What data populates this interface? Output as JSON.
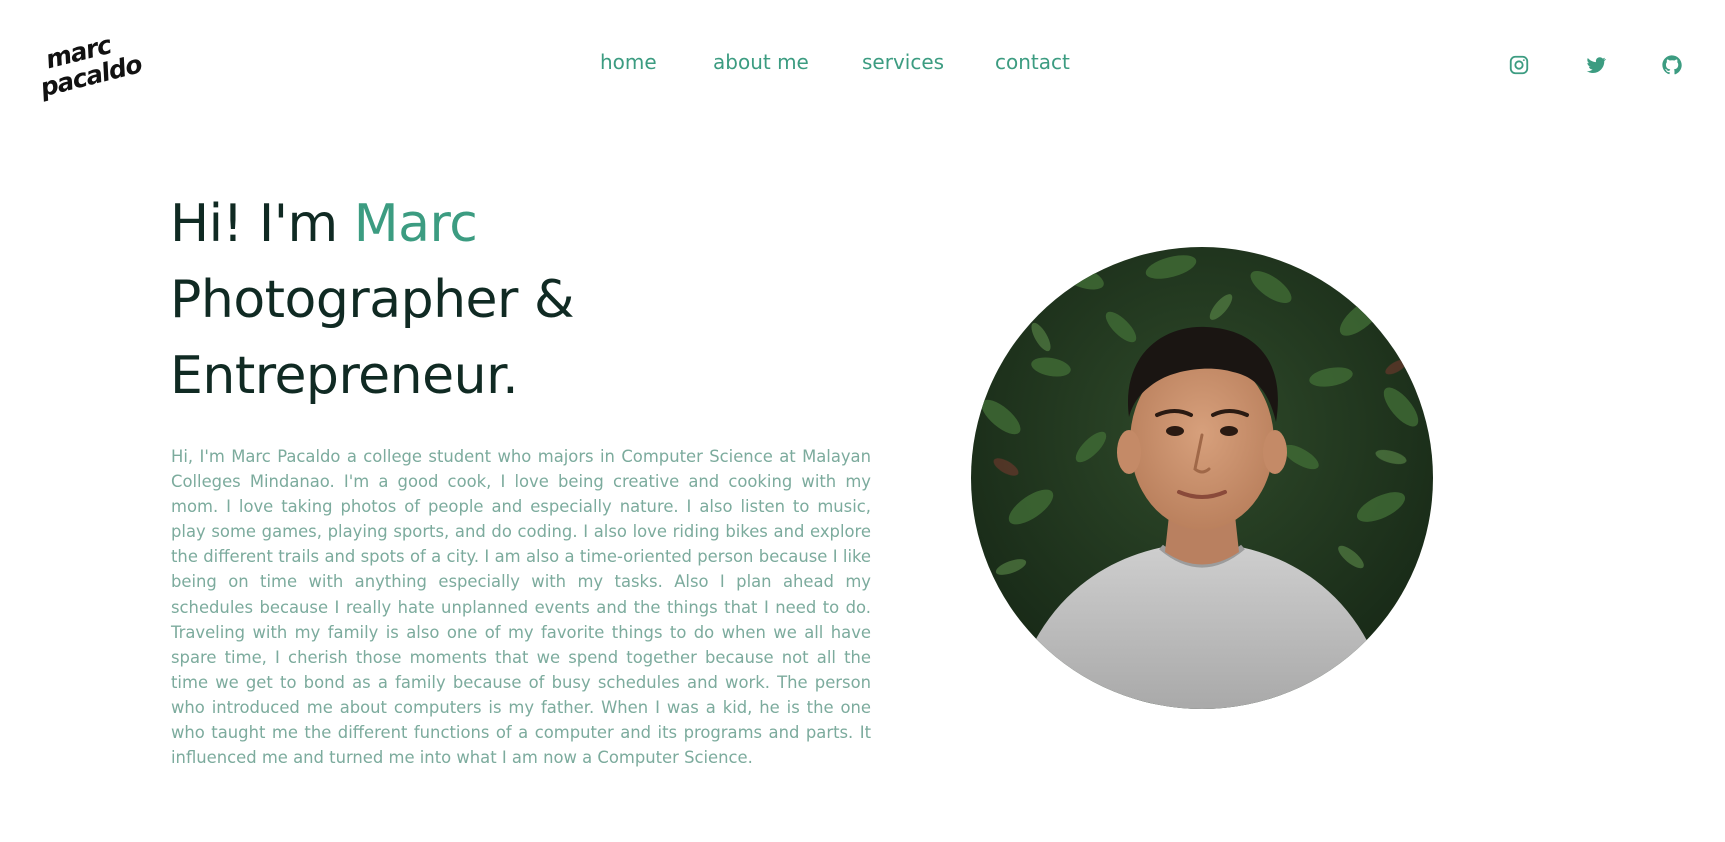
{
  "header": {
    "logo": {
      "line1": "marc",
      "line2": "pacaldo"
    },
    "nav": [
      {
        "label": "home"
      },
      {
        "label": "about me"
      },
      {
        "label": "services"
      },
      {
        "label": "contact"
      }
    ],
    "social": [
      {
        "icon": "instagram-icon"
      },
      {
        "icon": "twitter-icon"
      },
      {
        "icon": "github-icon"
      }
    ]
  },
  "hero": {
    "greeting": "Hi! I'm ",
    "name": "Marc",
    "line2": "Photographer &",
    "line3": "Entrepreneur.",
    "bio": "Hi, I'm Marc Pacaldo a college student who majors in Computer Science at Malayan Colleges Mindanao. I'm a good cook, I love being creative and cooking with my mom. I love taking photos of people and especially nature. I also listen to music, play some games, playing sports, and do coding. I also love riding bikes and explore the different trails and spots of a city. I am also a time-oriented person because I like being on time with anything especially with my tasks. Also I plan ahead my schedules because I really hate unplanned events and the things that I need to do. Traveling with my family is also one of my favorite things to do when we all have spare time, I cherish those moments that we spend together because not all the time we get to bond as a family because of busy schedules and work. The person who introduced me about computers is my father. When I was a kid, he is the one who taught me the different functions of a computer and its programs and parts. It influenced me and turned me into what I am now a Computer Science."
  },
  "colors": {
    "accent": "#3c9c81",
    "heading": "#102a23",
    "body_text": "#7cab9d",
    "background": "#ffffff"
  }
}
